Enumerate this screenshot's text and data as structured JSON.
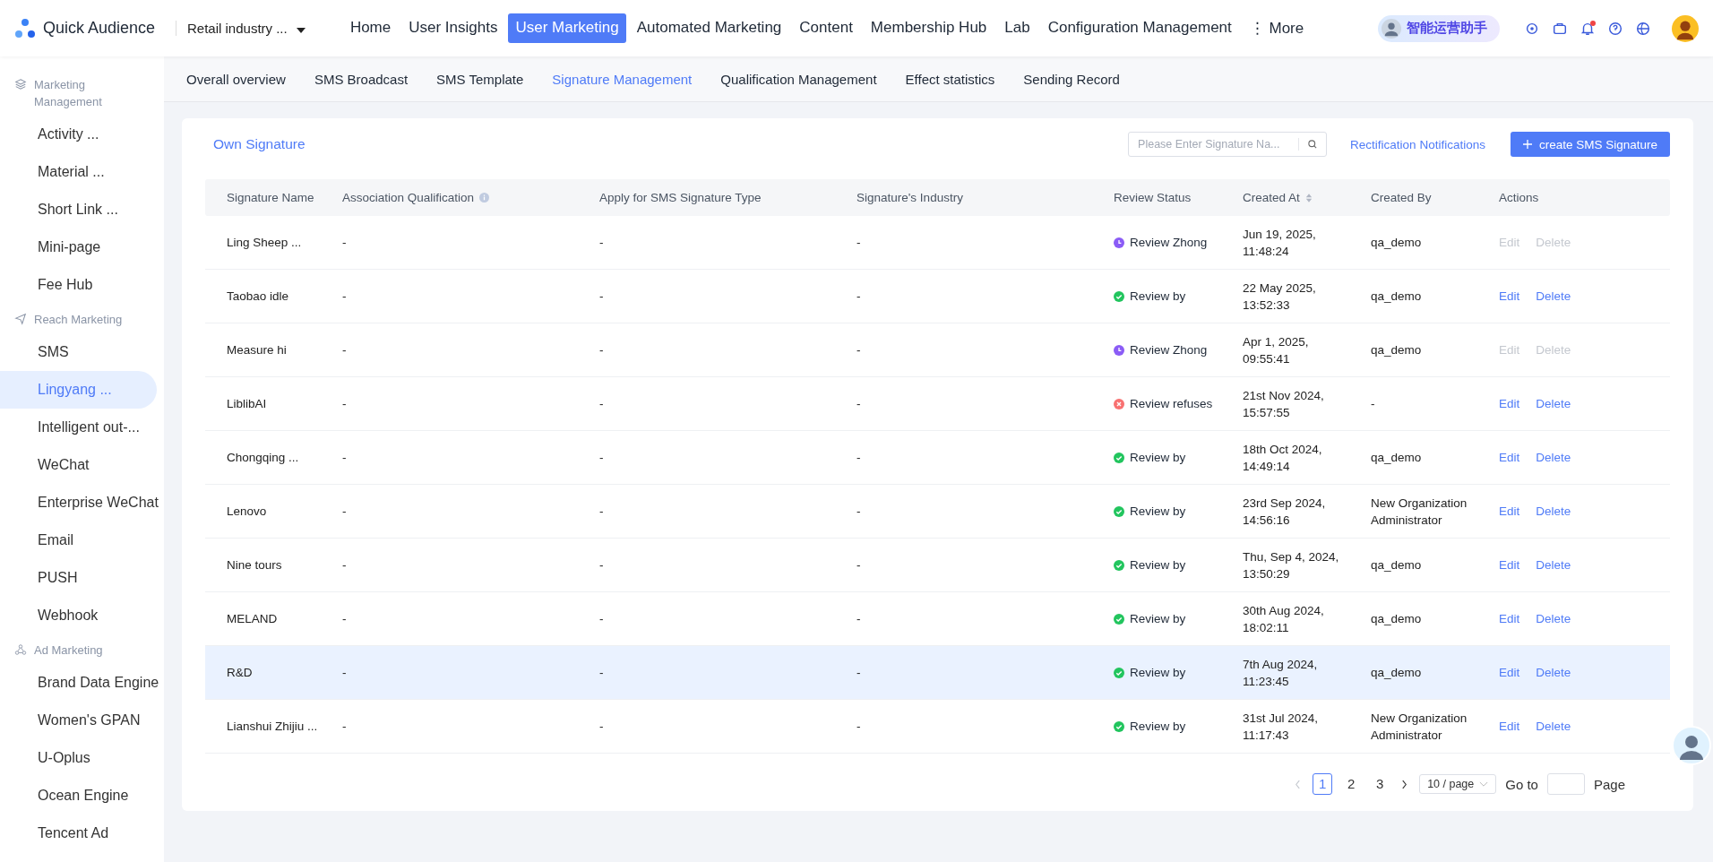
{
  "brand": {
    "name": "Quick Audience"
  },
  "org_select": {
    "value": "Retail industry ..."
  },
  "top_nav": [
    {
      "label": "Home",
      "selected": false
    },
    {
      "label": "User Insights",
      "selected": false
    },
    {
      "label": "User Marketing",
      "selected": true
    },
    {
      "label": "Automated Marketing",
      "selected": false
    },
    {
      "label": "Content",
      "selected": false
    },
    {
      "label": "Membership Hub",
      "selected": false
    },
    {
      "label": "Lab",
      "selected": false
    },
    {
      "label": "Configuration Management",
      "selected": false
    },
    {
      "label": "⋮ More",
      "selected": false
    }
  ],
  "assistant": {
    "label": "智能运营助手"
  },
  "notifications": {
    "unread": true
  },
  "sub_nav": [
    {
      "label": "Overall overview",
      "selected": false
    },
    {
      "label": "SMS Broadcast",
      "selected": false
    },
    {
      "label": "SMS Template",
      "selected": false
    },
    {
      "label": "Signature Management",
      "selected": true
    },
    {
      "label": "Qualification Management",
      "selected": false
    },
    {
      "label": "Effect statistics",
      "selected": false
    },
    {
      "label": "Sending Record",
      "selected": false
    }
  ],
  "sidebar": [
    {
      "kind": "section",
      "label": "Marketing Management"
    },
    {
      "kind": "item",
      "label": "Activity ...",
      "selected": false
    },
    {
      "kind": "item",
      "label": "Material ...",
      "selected": false
    },
    {
      "kind": "item",
      "label": "Short Link ...",
      "selected": false
    },
    {
      "kind": "item",
      "label": "Mini-page",
      "selected": false
    },
    {
      "kind": "item",
      "label": "Fee Hub",
      "selected": false
    },
    {
      "kind": "section",
      "label": "Reach Marketing"
    },
    {
      "kind": "item",
      "label": "SMS",
      "selected": false
    },
    {
      "kind": "item",
      "label": "Lingyang ...",
      "selected": true
    },
    {
      "kind": "item",
      "label": "Intelligent out-...",
      "selected": false
    },
    {
      "kind": "item",
      "label": "WeChat",
      "selected": false
    },
    {
      "kind": "item",
      "label": "Enterprise WeChat",
      "selected": false
    },
    {
      "kind": "item",
      "label": "Email",
      "selected": false
    },
    {
      "kind": "item",
      "label": "PUSH",
      "selected": false
    },
    {
      "kind": "item",
      "label": "Webhook",
      "selected": false
    },
    {
      "kind": "section",
      "label": "Ad Marketing"
    },
    {
      "kind": "item",
      "label": "Brand Data Engine",
      "selected": false
    },
    {
      "kind": "item",
      "label": "Women's GPAN",
      "selected": false
    },
    {
      "kind": "item",
      "label": "U-Oplus",
      "selected": false
    },
    {
      "kind": "item",
      "label": "Ocean Engine",
      "selected": false
    },
    {
      "kind": "item",
      "label": "Tencent Ad",
      "selected": false
    }
  ],
  "toolbar": {
    "tab": "Own Signature",
    "search_placeholder": "Please Enter Signature Na...",
    "link": "Rectification Notifications",
    "create_button": "create SMS Signature"
  },
  "table": {
    "columns": [
      "Signature Name",
      "Association Qualification",
      "Apply for SMS Signature Type",
      "Signature's Industry",
      "Review Status",
      "Created At",
      "Created By",
      "Actions"
    ],
    "rows": [
      {
        "name": "Ling Sheep ...",
        "qualification": "-",
        "type": "-",
        "industry": "-",
        "status": {
          "kind": "pending",
          "label": "Review Zhong"
        },
        "created_at": "Jun 19, 2025, 11:48:24",
        "created_by": "qa_demo",
        "actions": [
          {
            "label": "Edit",
            "disabled": true
          },
          {
            "label": "Delete",
            "disabled": true
          }
        ],
        "highlighted": false
      },
      {
        "name": "Taobao idle",
        "qualification": "-",
        "type": "-",
        "industry": "-",
        "status": {
          "kind": "approved",
          "label": "Review by"
        },
        "created_at": "22 May 2025, 13:52:33",
        "created_by": "qa_demo",
        "actions": [
          {
            "label": "Edit",
            "disabled": false
          },
          {
            "label": "Delete",
            "disabled": false
          }
        ],
        "highlighted": false
      },
      {
        "name": "Measure hi",
        "qualification": "-",
        "type": "-",
        "industry": "-",
        "status": {
          "kind": "pending",
          "label": "Review Zhong"
        },
        "created_at": "Apr 1, 2025, 09:55:41",
        "created_by": "qa_demo",
        "actions": [
          {
            "label": "Edit",
            "disabled": true
          },
          {
            "label": "Delete",
            "disabled": true
          }
        ],
        "highlighted": false
      },
      {
        "name": "LiblibAI",
        "qualification": "-",
        "type": "-",
        "industry": "-",
        "status": {
          "kind": "rejected",
          "label": "Review refuses"
        },
        "created_at": "21st Nov 2024, 15:57:55",
        "created_by": "-",
        "actions": [
          {
            "label": "Edit",
            "disabled": false
          },
          {
            "label": "Delete",
            "disabled": false
          }
        ],
        "highlighted": false
      },
      {
        "name": "Chongqing ...",
        "qualification": "-",
        "type": "-",
        "industry": "-",
        "status": {
          "kind": "approved",
          "label": "Review by"
        },
        "created_at": "18th Oct 2024, 14:49:14",
        "created_by": "qa_demo",
        "actions": [
          {
            "label": "Edit",
            "disabled": false
          },
          {
            "label": "Delete",
            "disabled": false
          }
        ],
        "highlighted": false
      },
      {
        "name": "Lenovo",
        "qualification": "-",
        "type": "-",
        "industry": "-",
        "status": {
          "kind": "approved",
          "label": "Review by"
        },
        "created_at": "23rd Sep 2024, 14:56:16",
        "created_by": "New Organization Administrator",
        "actions": [
          {
            "label": "Edit",
            "disabled": false
          },
          {
            "label": "Delete",
            "disabled": false
          }
        ],
        "highlighted": false
      },
      {
        "name": "Nine tours",
        "qualification": "-",
        "type": "-",
        "industry": "-",
        "status": {
          "kind": "approved",
          "label": "Review by"
        },
        "created_at": "Thu, Sep 4, 2024, 13:50:29",
        "created_by": "qa_demo",
        "actions": [
          {
            "label": "Edit",
            "disabled": false
          },
          {
            "label": "Delete",
            "disabled": false
          }
        ],
        "highlighted": false
      },
      {
        "name": "MELAND",
        "qualification": "-",
        "type": "-",
        "industry": "-",
        "status": {
          "kind": "approved",
          "label": "Review by"
        },
        "created_at": "30th Aug 2024, 18:02:11",
        "created_by": "qa_demo",
        "actions": [
          {
            "label": "Edit",
            "disabled": false
          },
          {
            "label": "Delete",
            "disabled": false
          }
        ],
        "highlighted": false
      },
      {
        "name": "R&D",
        "qualification": "-",
        "type": "-",
        "industry": "-",
        "status": {
          "kind": "approved",
          "label": "Review by"
        },
        "created_at": "7th Aug 2024, 11:23:45",
        "created_by": "qa_demo",
        "actions": [
          {
            "label": "Edit",
            "disabled": false
          },
          {
            "label": "Delete",
            "disabled": false
          }
        ],
        "highlighted": true
      },
      {
        "name": "Lianshui Zhijiu ...",
        "qualification": "-",
        "type": "-",
        "industry": "-",
        "status": {
          "kind": "approved",
          "label": "Review by"
        },
        "created_at": "31st Jul 2024, 11:17:43",
        "created_by": "New Organization Administrator",
        "actions": [
          {
            "label": "Edit",
            "disabled": false
          },
          {
            "label": "Delete",
            "disabled": false
          }
        ],
        "highlighted": false
      }
    ]
  },
  "pagination": {
    "prev_disabled": true,
    "pages": [
      {
        "label": "1",
        "selected": true
      },
      {
        "label": "2",
        "selected": false
      },
      {
        "label": "3",
        "selected": false
      }
    ],
    "page_size": "10 / page",
    "goto_label": "Go to",
    "page_label": "Page"
  }
}
